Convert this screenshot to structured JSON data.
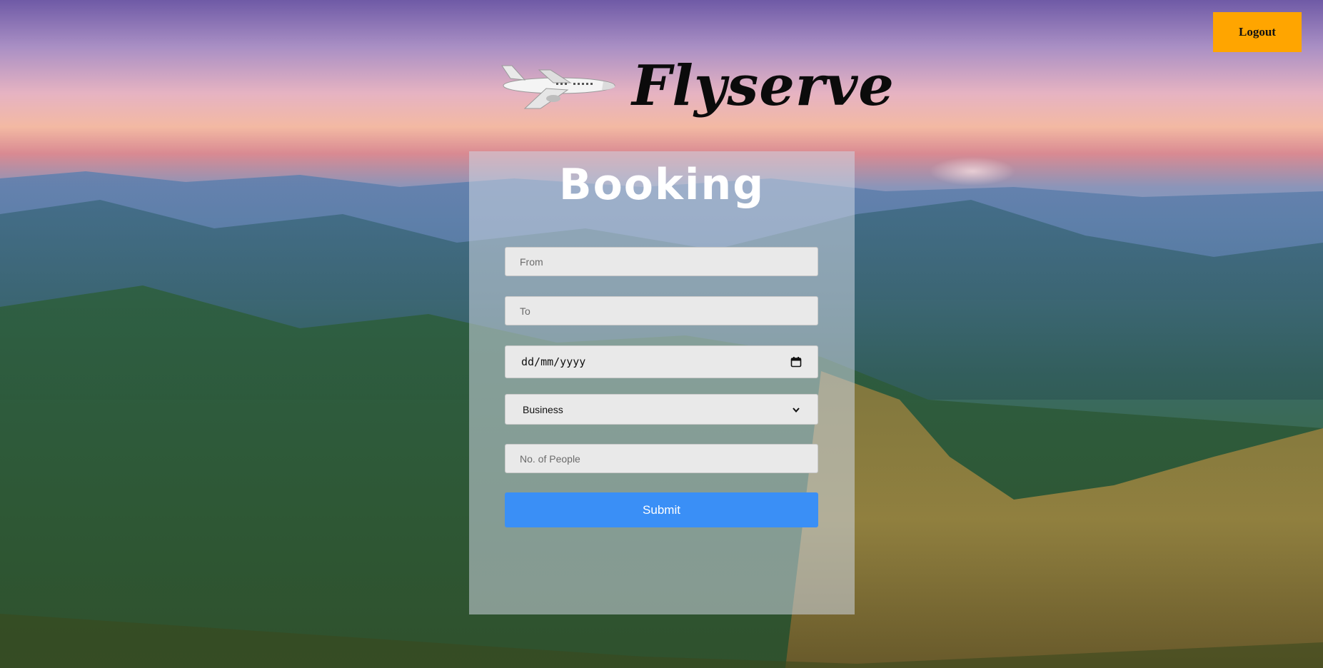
{
  "app": {
    "name": "Flyserve",
    "logo_icon": "airplane-icon"
  },
  "header": {
    "logout_label": "Logout",
    "logout_color": "#ffa500"
  },
  "booking_form": {
    "title": "Booking",
    "from": {
      "placeholder": "From",
      "value": ""
    },
    "to": {
      "placeholder": "To",
      "value": ""
    },
    "date": {
      "display": "dd/mm/yyyy",
      "icon": "calendar-icon"
    },
    "travel_class": {
      "selected": "Business",
      "icon": "chevron-down-icon"
    },
    "people": {
      "placeholder": "No. of People",
      "value": ""
    },
    "submit_label": "Submit",
    "submit_color": "#3a8ff6"
  }
}
